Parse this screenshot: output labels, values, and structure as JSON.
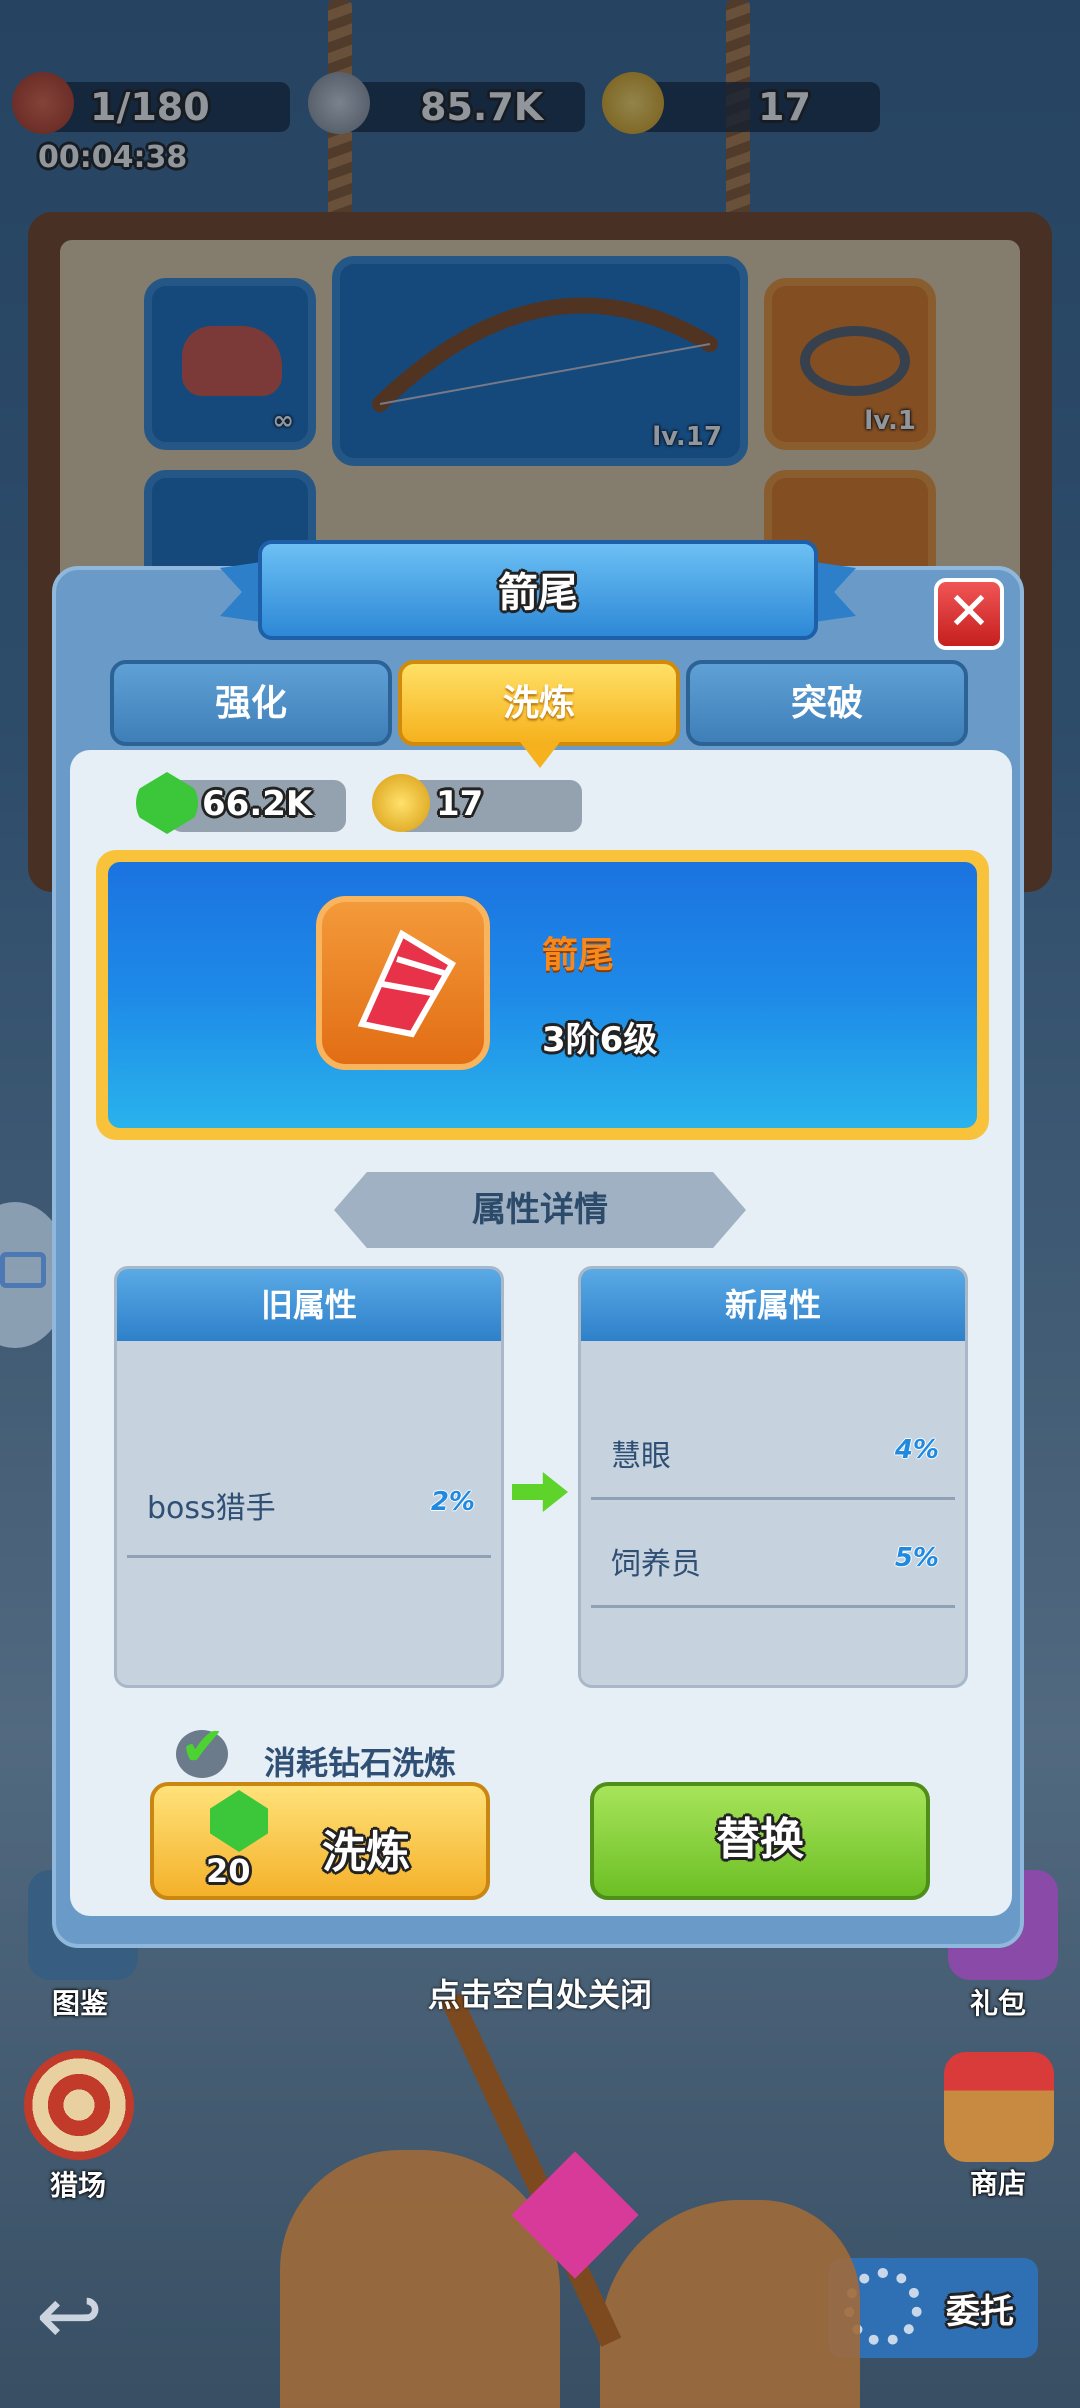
{
  "status_bar": {
    "meat": "1/180",
    "silver": "85.7K",
    "gold": "17",
    "timer": "00:04:38"
  },
  "background_slots": {
    "meat_qty": "∞",
    "bow_level": "lv.17",
    "rope_level": "lv.1"
  },
  "dialog": {
    "title": "箭尾",
    "close_symbol": "✕",
    "tabs": [
      {
        "label": "强化",
        "active": false
      },
      {
        "label": "洗炼",
        "active": true
      },
      {
        "label": "突破",
        "active": false
      }
    ],
    "resources": {
      "gems": "66.2K",
      "gold": "17"
    },
    "item": {
      "name": "箭尾",
      "rank": "3阶6级"
    },
    "section_title": "属性详情",
    "old_panel": {
      "title": "旧属性",
      "rows": [
        {
          "name": "boss猎手",
          "value": "2%"
        }
      ]
    },
    "new_panel": {
      "title": "新属性",
      "rows": [
        {
          "name": "慧眼",
          "value": "4%"
        },
        {
          "name": "饲养员",
          "value": "5%"
        }
      ]
    },
    "checkbox_label": "消耗钻石洗炼",
    "refine_button": {
      "label": "洗炼",
      "cost": "20"
    },
    "replace_button": "替换"
  },
  "close_hint": "点击空白处关闭",
  "side_menu": {
    "left": [
      "图鉴",
      "猎场"
    ],
    "right": [
      "礼包",
      "商店"
    ],
    "bottom_right": "委托"
  },
  "colors": {
    "accent_gold": "#f6b21e",
    "accent_green": "#6cbf25",
    "panel_blue": "#2e80c9",
    "item_orange": "#e26d14"
  },
  "icons": [
    "meat-icon",
    "silver-coin-icon",
    "gold-coin-icon",
    "gem-icon",
    "arrow-right-icon",
    "check-icon",
    "close-icon",
    "back-icon",
    "gear-icon"
  ]
}
